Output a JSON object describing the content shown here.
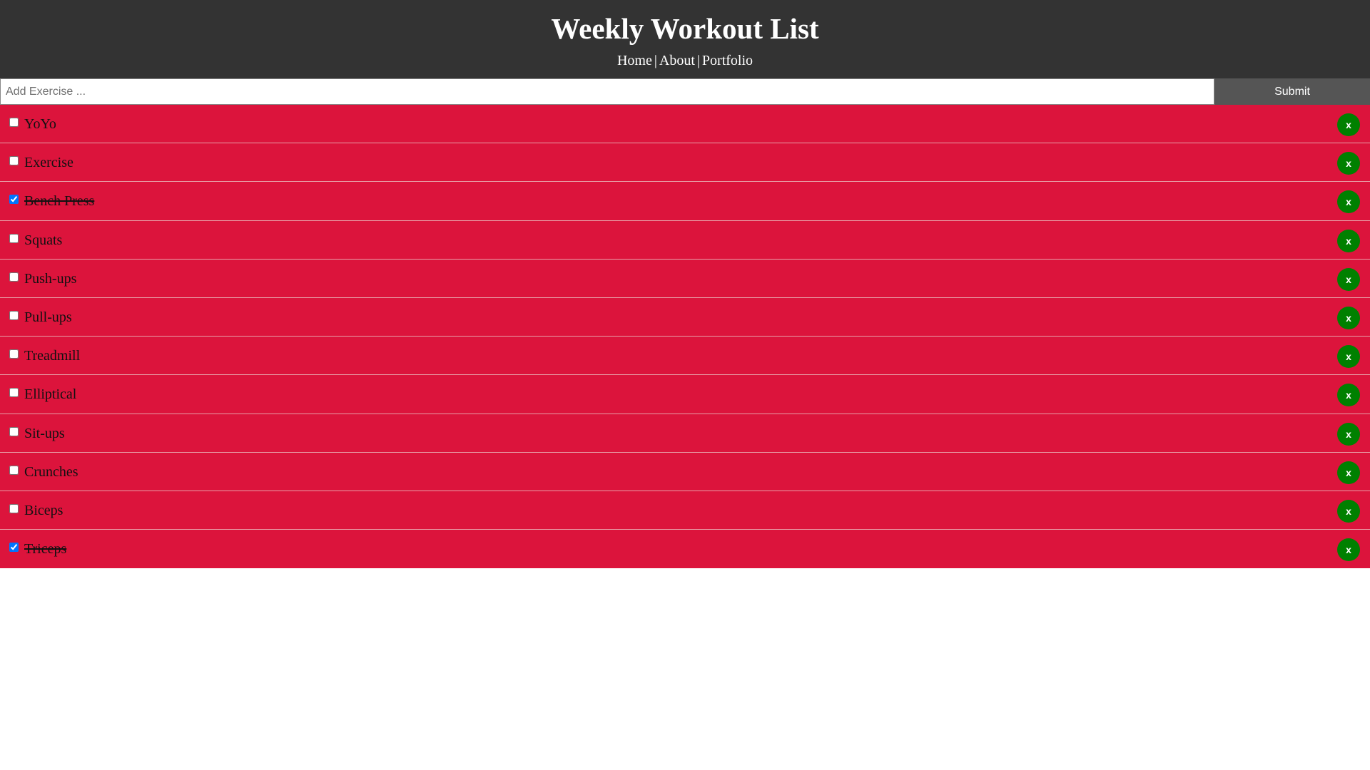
{
  "header": {
    "title": "Weekly Workout List",
    "nav": [
      {
        "label": "Home"
      },
      {
        "label": "About"
      },
      {
        "label": "Portfolio"
      }
    ],
    "separator": "|"
  },
  "add_form": {
    "placeholder": "Add Exercise ...",
    "value": "",
    "submit_label": "Submit"
  },
  "items": [
    {
      "label": "YoYo",
      "checked": false,
      "delete_label": "x"
    },
    {
      "label": "Exercise",
      "checked": false,
      "delete_label": "x"
    },
    {
      "label": "Bench Press",
      "checked": true,
      "delete_label": "x"
    },
    {
      "label": "Squats",
      "checked": false,
      "delete_label": "x"
    },
    {
      "label": "Push-ups",
      "checked": false,
      "delete_label": "x"
    },
    {
      "label": "Pull-ups",
      "checked": false,
      "delete_label": "x"
    },
    {
      "label": "Treadmill",
      "checked": false,
      "delete_label": "x"
    },
    {
      "label": "Elliptical",
      "checked": false,
      "delete_label": "x"
    },
    {
      "label": "Sit-ups",
      "checked": false,
      "delete_label": "x"
    },
    {
      "label": "Crunches",
      "checked": false,
      "delete_label": "x"
    },
    {
      "label": "Biceps",
      "checked": false,
      "delete_label": "x"
    },
    {
      "label": "Triceps",
      "checked": true,
      "delete_label": "x"
    }
  ],
  "colors": {
    "header_bg": "#333333",
    "item_bg": "#dc143c",
    "delete_bg": "#008000",
    "submit_bg": "#555555"
  }
}
